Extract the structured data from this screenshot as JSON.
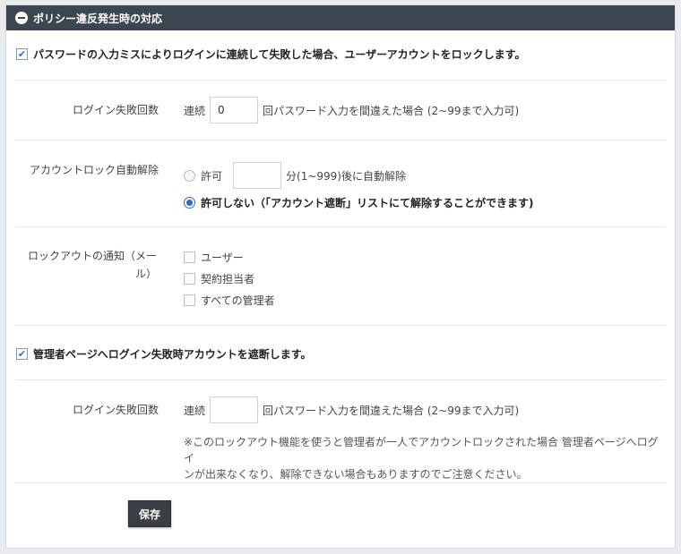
{
  "header": {
    "title": "ポリシー違反発生時の対応"
  },
  "section1": {
    "lock_checkbox_label": "パスワードの入力ミスによりログインに連続して失敗した場合、ユーザーアカウントをロックします。",
    "lock_checkbox_checked": true,
    "failures": {
      "label": "ログイン失敗回数",
      "prefix": "連続",
      "value": "0",
      "suffix": "回パスワード入力を間違えた場合 (2~99まで入力可)"
    },
    "auto_unlock": {
      "label": "アカウントロック自動解除",
      "allow_label": "許可",
      "minutes_value": "",
      "allow_suffix": "分(1~999)後に自動解除",
      "deny_label": "許可しない（「アカウント遮断」リストにて解除することができます)",
      "selected": "deny"
    },
    "notify": {
      "label_line1": "ロックアウトの通知（メー",
      "label_line2": "ル）",
      "options": [
        {
          "label": "ユーザー",
          "checked": false
        },
        {
          "label": "契約担当者",
          "checked": false
        },
        {
          "label": "すべての管理者",
          "checked": false
        }
      ]
    }
  },
  "section2": {
    "admin_checkbox_label": "管理者ページへログイン失敗時アカウントを遮断します。",
    "admin_checkbox_checked": true,
    "failures": {
      "label": "ログイン失敗回数",
      "prefix": "連続",
      "value": "",
      "suffix": "回パスワード入力を間違えた場合 (2~99まで入力可)"
    },
    "note_line1": "※このロックアウト機能を使うと管理者が一人でアカウントロックされた場合 管理者ページへログイ",
    "note_line2": "ンが出来なくなり、解除できない場合もありますのでご注意ください。"
  },
  "footer": {
    "save_label": "保存"
  },
  "colors": {
    "header_bg": "#3d4650",
    "accent": "#2c6cc4",
    "button_bg": "#3a3f45"
  }
}
